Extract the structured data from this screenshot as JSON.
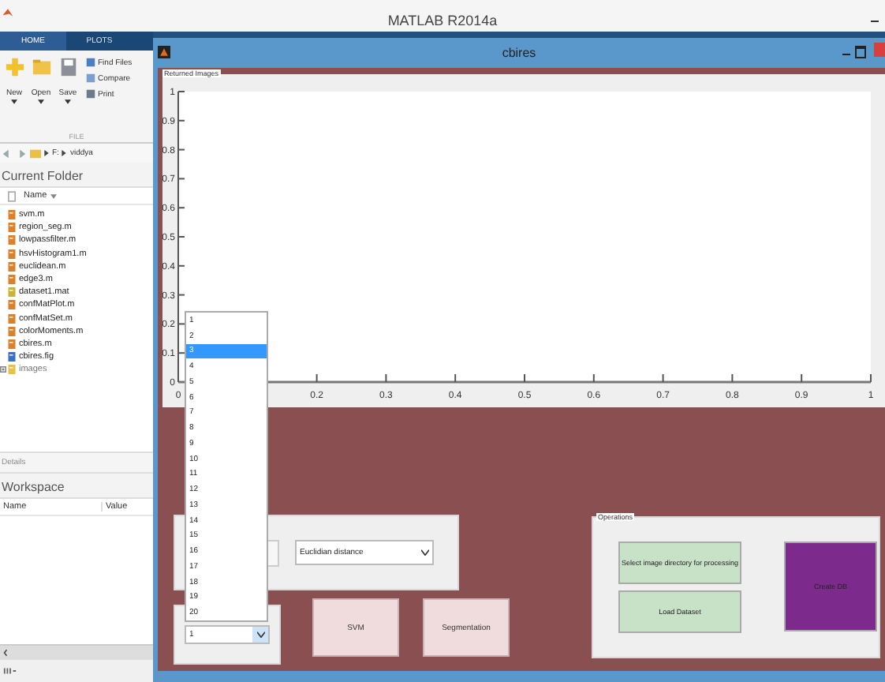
{
  "app_title": "MATLAB R2014a",
  "ribbon": {
    "tabs": [
      {
        "label": "HOME",
        "selected": true
      },
      {
        "label": "PLOTS",
        "selected": false
      }
    ],
    "big_buttons": [
      {
        "label": "New",
        "kind": "new"
      },
      {
        "label": "Open",
        "kind": "open"
      },
      {
        "label": "Save",
        "kind": "save"
      }
    ],
    "small_buttons": [
      {
        "label": "Find Files",
        "kind": "find"
      },
      {
        "label": "Compare",
        "kind": "compare"
      },
      {
        "label": "Print",
        "kind": "print"
      }
    ],
    "section": "FILE"
  },
  "path": [
    "F:",
    "viddya"
  ],
  "current_folder": {
    "title": "Current Folder",
    "column": "Name",
    "files": [
      {
        "name": "svm.m",
        "kind": "m"
      },
      {
        "name": "region_seg.m",
        "kind": "m"
      },
      {
        "name": "lowpassfilter.m",
        "kind": "m"
      },
      {
        "name": "hsvHistogram1.m",
        "kind": "m"
      },
      {
        "name": "euclidean.m",
        "kind": "m"
      },
      {
        "name": "edge3.m",
        "kind": "m"
      },
      {
        "name": "dataset1.mat",
        "kind": "mat"
      },
      {
        "name": "confMatPlot.m",
        "kind": "m"
      },
      {
        "name": "confMatSet.m",
        "kind": "m"
      },
      {
        "name": "colorMoments.m",
        "kind": "m"
      },
      {
        "name": "cbires.m",
        "kind": "m"
      },
      {
        "name": "cbires.fig",
        "kind": "fig"
      },
      {
        "name": "images",
        "kind": "folder"
      }
    ]
  },
  "details": "Details",
  "workspace": {
    "title": "Workspace",
    "columns": [
      "Name",
      "Value"
    ]
  },
  "figure": {
    "title": "cbires",
    "panel_title": "Returned Images",
    "chart_data": {
      "type": "line",
      "xlim": [
        0,
        1
      ],
      "ylim": [
        0,
        1
      ],
      "xticks": [
        0,
        0.2,
        0.3,
        0.4,
        0.5,
        0.6,
        0.7,
        0.8,
        0.9,
        1
      ],
      "yticks": [
        0,
        0.1,
        0.2,
        0.3,
        0.4,
        0.5,
        0.6,
        0.7,
        0.8,
        0.9,
        1
      ]
    },
    "popup_list": [
      {
        "label": "1",
        "selected": false
      },
      {
        "label": "2",
        "selected": false
      },
      {
        "label": "3",
        "selected": true
      },
      {
        "label": "4",
        "selected": false
      },
      {
        "label": "5",
        "selected": false
      },
      {
        "label": "6",
        "selected": false
      },
      {
        "label": "7",
        "selected": false
      },
      {
        "label": "8",
        "selected": false
      },
      {
        "label": "9",
        "selected": false
      },
      {
        "label": "10",
        "selected": false
      },
      {
        "label": "11",
        "selected": false
      },
      {
        "label": "12",
        "selected": false
      },
      {
        "label": "13",
        "selected": false
      },
      {
        "label": "14",
        "selected": false
      },
      {
        "label": "15",
        "selected": false
      },
      {
        "label": "16",
        "selected": false
      },
      {
        "label": "17",
        "selected": false
      },
      {
        "label": "18",
        "selected": false
      },
      {
        "label": "19",
        "selected": false
      },
      {
        "label": "20",
        "selected": false
      }
    ],
    "distance_menu": "Euclidian distance",
    "count_menu": "1",
    "buttons": [
      {
        "label": "SVM",
        "color": "#f0dcdc"
      },
      {
        "label": "Segmentation",
        "color": "#f0dcdc"
      }
    ],
    "operations": {
      "title": "Operations",
      "buttons": [
        {
          "label": "Select image directory for processing",
          "color": "#c8e2c8",
          "kind": "wide"
        },
        {
          "label": "Load Dataset",
          "color": "#c8e2c8",
          "kind": "wide"
        },
        {
          "label": "Create DB",
          "color": "#7c2a8c",
          "kind": "tall"
        }
      ]
    }
  }
}
